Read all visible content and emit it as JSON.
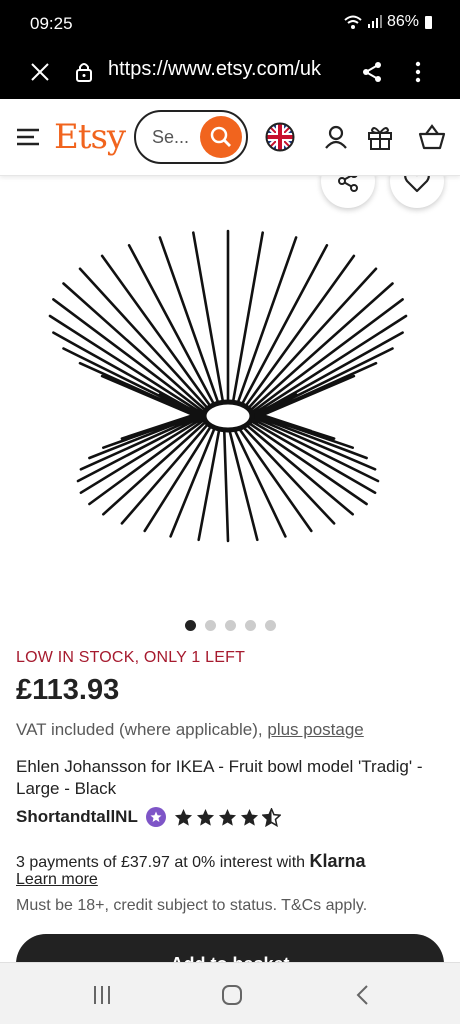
{
  "status": {
    "time": "09:25",
    "battery": "86%"
  },
  "browser": {
    "url": "https://www.etsy.com/uk"
  },
  "header": {
    "logo": "Etsy",
    "search_placeholder": "Se..."
  },
  "gallery": {
    "image_count": 5,
    "active_index": 0
  },
  "product": {
    "stock": "LOW IN STOCK, ONLY 1 LEFT",
    "price": "£113.93",
    "vat_text": "VAT included (where applicable), ",
    "postage_link": "plus postage",
    "title": "Ehlen Johansson for IKEA - Fruit bowl model 'Tradig' - Large - Black",
    "shop_name": "ShortandtallNL",
    "rating": 4.5
  },
  "klarna": {
    "text": "3 payments of £37.97 at 0% interest with ",
    "brand": "Klarna",
    "learn_more": "Learn more",
    "terms": "Must be 18+, credit subject to status. T&Cs apply."
  },
  "cta": {
    "add_to_basket": "Add to basket"
  },
  "colors": {
    "accent": "#f1641e",
    "stock": "#a61a2e",
    "star_seller": "#7e55c7"
  }
}
